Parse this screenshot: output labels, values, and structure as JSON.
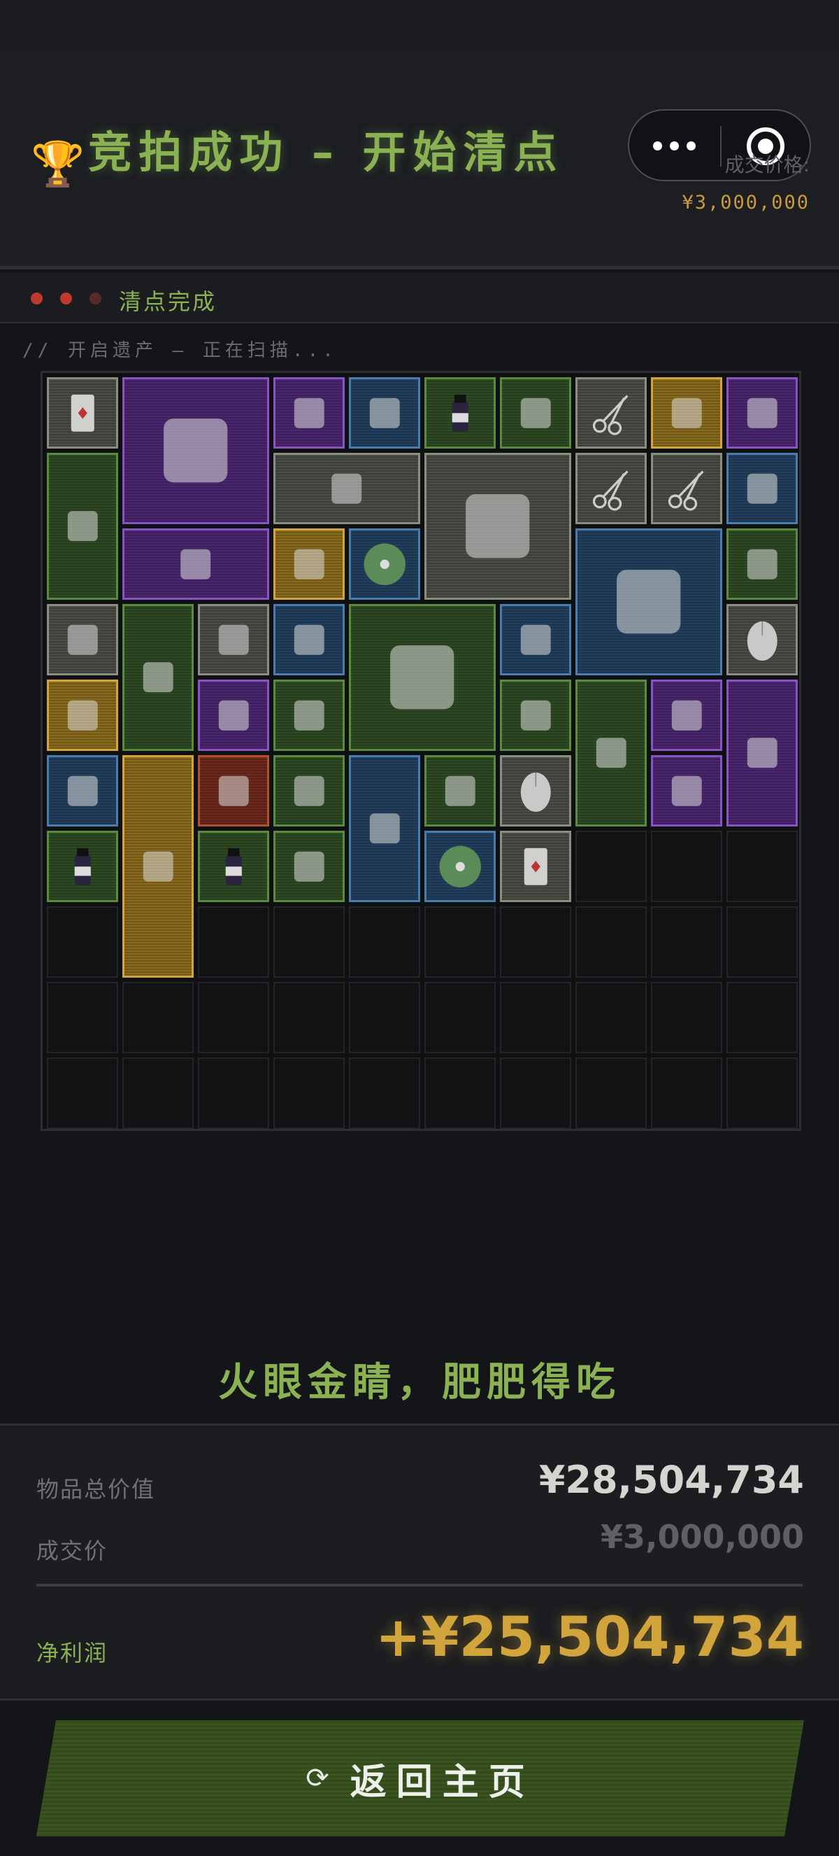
{
  "header": {
    "trophy_icon": "trophy-icon",
    "title": "竞拍成功 – 开始清点",
    "deal_label": "成交价格:",
    "deal_value": "¥3,000,000"
  },
  "capsule": {
    "more_icon": "more-dots-icon",
    "close_icon": "target-circle-icon"
  },
  "status": {
    "dots": [
      "#c0392b",
      "#c0392b",
      "#5a2a2a"
    ],
    "text": "清点完成"
  },
  "scan": {
    "text": "// 开启遗产 – 正在扫描..."
  },
  "grid": {
    "items": [
      {
        "name": "playing-card",
        "rarity": "gray"
      },
      {
        "name": "motherboard",
        "rarity": "purple"
      },
      {
        "name": "folding-knife",
        "rarity": "purple"
      },
      {
        "name": "usb-drive",
        "rarity": "blue"
      },
      {
        "name": "medicine-bottle",
        "rarity": "green"
      },
      {
        "name": "battery-pack",
        "rarity": "green"
      },
      {
        "name": "scissors",
        "rarity": "gray"
      },
      {
        "name": "pocket-watch",
        "rarity": "gold"
      },
      {
        "name": "ornate-dagger",
        "rarity": "purple"
      },
      {
        "name": "djembe-drum",
        "rarity": "green"
      },
      {
        "name": "hammer",
        "rarity": "gray"
      },
      {
        "name": "candle-box",
        "rarity": "gray"
      },
      {
        "name": "scissors",
        "rarity": "gray"
      },
      {
        "name": "scissors",
        "rarity": "gray"
      },
      {
        "name": "phone",
        "rarity": "blue"
      },
      {
        "name": "horn-necklace",
        "rarity": "purple"
      },
      {
        "name": "vr-part",
        "rarity": "gold"
      },
      {
        "name": "cd-disc",
        "rarity": "blue"
      },
      {
        "name": "gas-cylinder",
        "rarity": "blue"
      },
      {
        "name": "protein-bar",
        "rarity": "green"
      },
      {
        "name": "cpu-cooler",
        "rarity": "gray"
      },
      {
        "name": "leather-wallet",
        "rarity": "green"
      },
      {
        "name": "cloth",
        "rarity": "gray"
      },
      {
        "name": "power-bank",
        "rarity": "blue"
      },
      {
        "name": "magazine",
        "rarity": "green"
      },
      {
        "name": "match-box",
        "rarity": "blue"
      },
      {
        "name": "computer-mouse",
        "rarity": "gray"
      },
      {
        "name": "silver-coin",
        "rarity": "gold"
      },
      {
        "name": "earrings",
        "rarity": "purple"
      },
      {
        "name": "coffee-jar",
        "rarity": "green"
      },
      {
        "name": "lighter",
        "rarity": "green"
      },
      {
        "name": "spirit-level",
        "rarity": "green"
      },
      {
        "name": "chip-card",
        "rarity": "purple"
      },
      {
        "name": "lantern",
        "rarity": "purple"
      },
      {
        "name": "soda-can",
        "rarity": "blue"
      },
      {
        "name": "glass-tube",
        "rarity": "gold"
      },
      {
        "name": "crystal-ball",
        "rarity": "red"
      },
      {
        "name": "9v-battery",
        "rarity": "green"
      },
      {
        "name": "stethoscope",
        "rarity": "blue"
      },
      {
        "name": "rolled-map",
        "rarity": "green"
      },
      {
        "name": "computer-mouse",
        "rarity": "gray"
      },
      {
        "name": "snack-bar",
        "rarity": "purple"
      },
      {
        "name": "medicine-bottle",
        "rarity": "green"
      },
      {
        "name": "medicine-bottle",
        "rarity": "green"
      },
      {
        "name": "wrench",
        "rarity": "green"
      },
      {
        "name": "cd-disc",
        "rarity": "blue"
      },
      {
        "name": "playing-card",
        "rarity": "gray"
      }
    ]
  },
  "slogan": "火眼金睛，肥肥得吃",
  "summary": {
    "total_label": "物品总价值",
    "total_value": "¥28,504,734",
    "deal_label": "成交价",
    "deal_value": "¥3,000,000",
    "profit_label": "净利润",
    "profit_value": "+¥25,504,734"
  },
  "home_button": {
    "icon": "refresh-icon",
    "label": "返回主页"
  }
}
